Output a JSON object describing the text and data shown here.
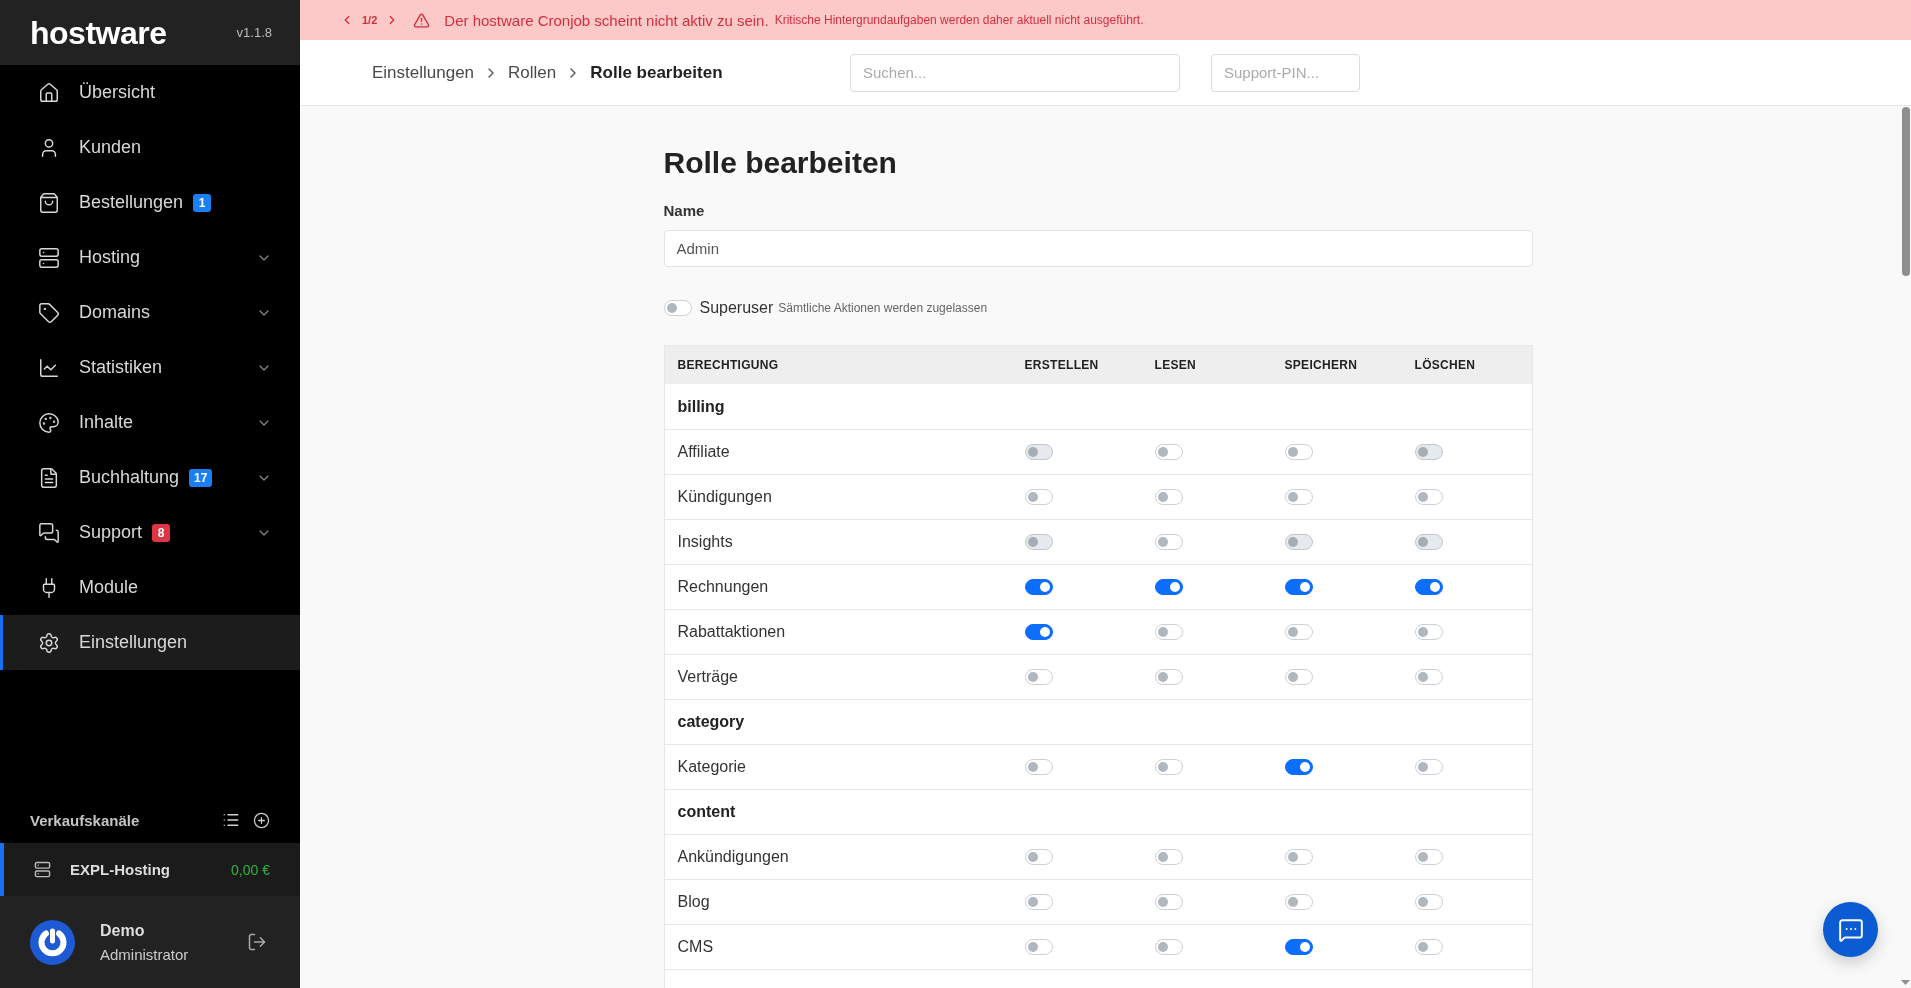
{
  "banner": {
    "pager": "1/2",
    "message": "Der hostware Cronjob scheint nicht aktiv zu sein.",
    "detail": "Kritische Hintergrundaufgaben werden daher aktuell nicht ausgeführt."
  },
  "sidebar": {
    "logo": "hostware",
    "version": "v1.1.8",
    "items": [
      {
        "label": "Übersicht",
        "selected": false
      },
      {
        "label": "Kunden",
        "selected": false
      },
      {
        "label": "Bestellungen",
        "selected": false,
        "badge": {
          "text": "1",
          "color": "#1a7ff5"
        }
      },
      {
        "label": "Hosting",
        "selected": false,
        "expanded": false
      },
      {
        "label": "Domains",
        "selected": false,
        "expanded": false
      },
      {
        "label": "Statistiken",
        "selected": false,
        "expanded": false
      },
      {
        "label": "Inhalte",
        "selected": false,
        "expanded": false
      },
      {
        "label": "Buchhaltung",
        "selected": false,
        "expanded": false,
        "badge": {
          "text": "17",
          "color": "#1a7ff5"
        }
      },
      {
        "label": "Support",
        "selected": false,
        "expanded": false,
        "badge": {
          "text": "8",
          "color": "#dc3545"
        }
      },
      {
        "label": "Module",
        "selected": false
      },
      {
        "label": "Einstellungen",
        "selected": true
      }
    ]
  },
  "sales_channels": {
    "title": "Verkaufskanäle",
    "items": [
      {
        "name": "EXPL-Hosting",
        "balance": "0,00 €",
        "selected": true
      }
    ]
  },
  "user": {
    "name": "Demo",
    "role": "Administrator"
  },
  "header": {
    "breadcrumb": [
      "Einstellungen",
      "Rollen",
      "Rolle bearbeiten"
    ],
    "search": {
      "placeholder": "Suchen..."
    },
    "support_pin": {
      "placeholder": "Support-PIN..."
    }
  },
  "form": {
    "title": "Rolle bearbeiten",
    "name_field": {
      "label": "Name",
      "value": "Admin"
    },
    "superuser": {
      "label": "Superuser",
      "hint": "Sämtliche Aktionen werden zugelassen",
      "on": false
    }
  },
  "table": {
    "columns": [
      "BERECHTIGUNG",
      "ERSTELLEN",
      "LESEN",
      "SPEICHERN",
      "LÖSCHEN"
    ],
    "rows": [
      {
        "kind": "group",
        "label": "billing"
      },
      {
        "kind": "permission",
        "label": "Affiliate",
        "toggles": [
          {
            "on": false,
            "disabled": true
          },
          {
            "on": false,
            "disabled": false
          },
          {
            "on": false,
            "disabled": false
          },
          {
            "on": false,
            "disabled": true
          }
        ]
      },
      {
        "kind": "permission",
        "label": "Kündigungen",
        "toggles": [
          {
            "on": false,
            "disabled": false
          },
          {
            "on": false,
            "disabled": false
          },
          {
            "on": false,
            "disabled": false
          },
          {
            "on": false,
            "disabled": false
          }
        ]
      },
      {
        "kind": "permission",
        "label": "Insights",
        "toggles": [
          {
            "on": false,
            "disabled": true
          },
          {
            "on": false,
            "disabled": false
          },
          {
            "on": false,
            "disabled": true
          },
          {
            "on": false,
            "disabled": true
          }
        ]
      },
      {
        "kind": "permission",
        "label": "Rechnungen",
        "toggles": [
          {
            "on": true,
            "disabled": false
          },
          {
            "on": true,
            "disabled": false
          },
          {
            "on": true,
            "disabled": false
          },
          {
            "on": true,
            "disabled": false
          }
        ]
      },
      {
        "kind": "permission",
        "label": "Rabattaktionen",
        "toggles": [
          {
            "on": true,
            "disabled": false
          },
          {
            "on": false,
            "disabled": false
          },
          {
            "on": false,
            "disabled": false
          },
          {
            "on": false,
            "disabled": false
          }
        ]
      },
      {
        "kind": "permission",
        "label": "Verträge",
        "toggles": [
          {
            "on": false,
            "disabled": false
          },
          {
            "on": false,
            "disabled": false
          },
          {
            "on": false,
            "disabled": false
          },
          {
            "on": false,
            "disabled": false
          }
        ]
      },
      {
        "kind": "group",
        "label": "category"
      },
      {
        "kind": "permission",
        "label": "Kategorie",
        "toggles": [
          {
            "on": false,
            "disabled": false
          },
          {
            "on": false,
            "disabled": false
          },
          {
            "on": true,
            "disabled": false
          },
          {
            "on": false,
            "disabled": false
          }
        ]
      },
      {
        "kind": "group",
        "label": "content"
      },
      {
        "kind": "permission",
        "label": "Ankündigungen",
        "toggles": [
          {
            "on": false,
            "disabled": false
          },
          {
            "on": false,
            "disabled": false
          },
          {
            "on": false,
            "disabled": false
          },
          {
            "on": false,
            "disabled": false
          }
        ]
      },
      {
        "kind": "permission",
        "label": "Blog",
        "toggles": [
          {
            "on": false,
            "disabled": false
          },
          {
            "on": false,
            "disabled": false
          },
          {
            "on": false,
            "disabled": false
          },
          {
            "on": false,
            "disabled": false
          }
        ]
      },
      {
        "kind": "permission",
        "label": "CMS",
        "toggles": [
          {
            "on": false,
            "disabled": false
          },
          {
            "on": false,
            "disabled": false
          },
          {
            "on": true,
            "disabled": false
          },
          {
            "on": false,
            "disabled": false
          }
        ]
      }
    ]
  }
}
